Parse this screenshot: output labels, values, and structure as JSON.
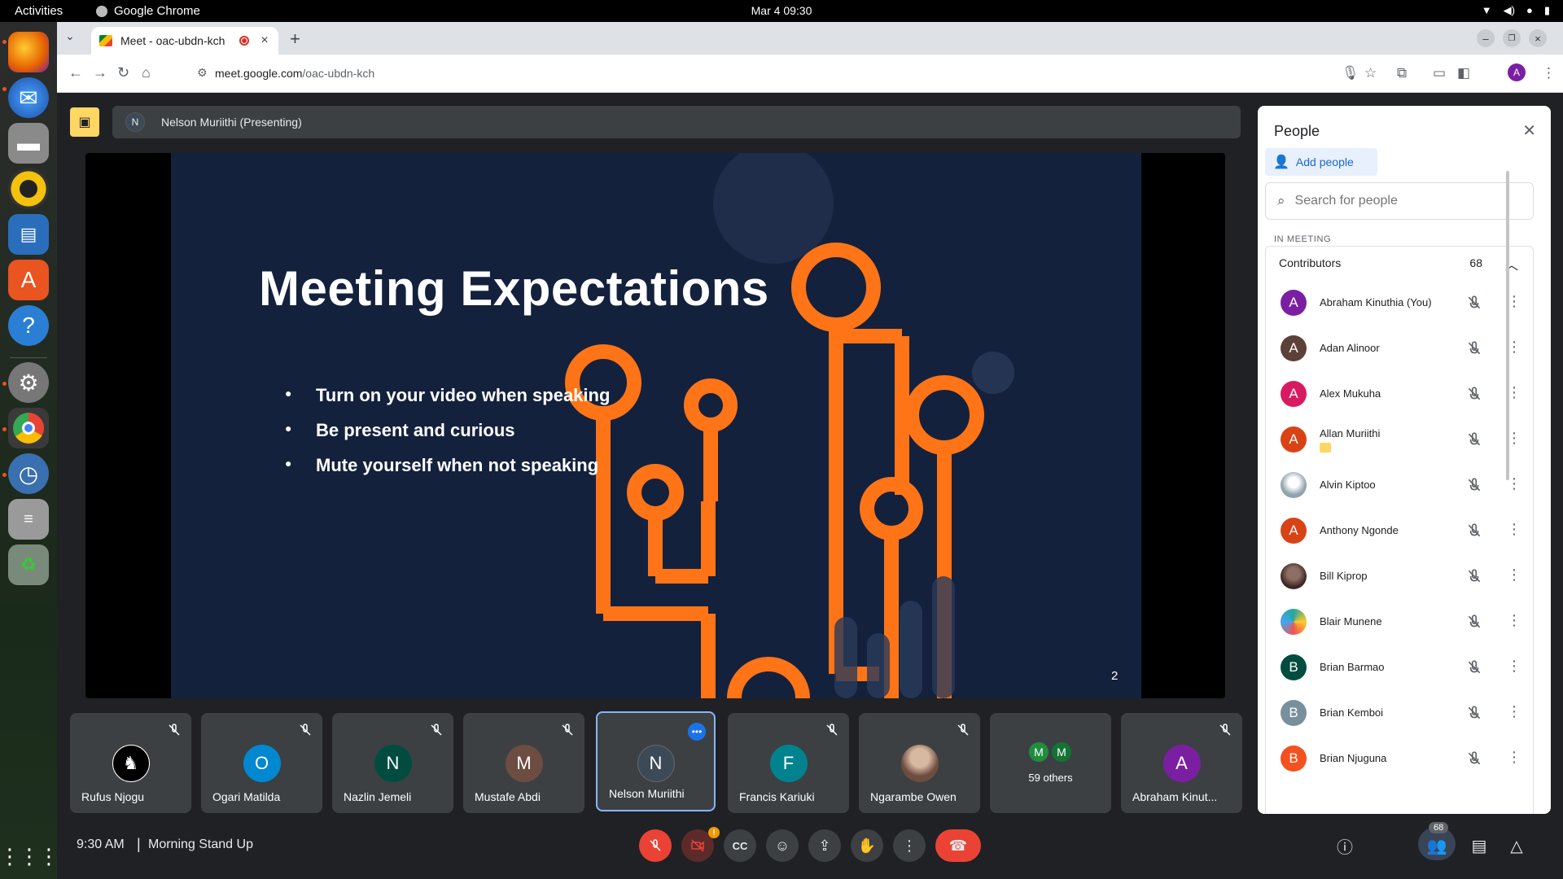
{
  "os": {
    "activities": "Activities",
    "app_name": "Google Chrome",
    "clock": "Mar 4  09:30"
  },
  "dock": {
    "items": [
      {
        "icon": "firefox-icon",
        "color": "#e66000"
      },
      {
        "icon": "thunderbird-icon",
        "color": "#2a6ccc"
      },
      {
        "icon": "files-icon",
        "color": "#8a8a8a"
      },
      {
        "icon": "rhythmbox-icon",
        "color": "#f4c20d"
      },
      {
        "icon": "writer-icon",
        "color": "#2a6ebb"
      },
      {
        "icon": "app-center-icon",
        "color": "#e95420"
      },
      {
        "icon": "help-icon",
        "color": "#2a7fd4"
      },
      {
        "icon": "settings-icon",
        "color": "#777777"
      },
      {
        "icon": "chrome-icon",
        "color": "#4285f4"
      },
      {
        "icon": "timer-icon",
        "color": "#3a6fb0"
      },
      {
        "icon": "storage-icon",
        "color": "#9a9a9a"
      },
      {
        "icon": "trash-icon",
        "color": "#7a8a7a"
      }
    ]
  },
  "browser": {
    "tab_title": "Meet - oac-ubdn-kch",
    "url_host": "meet.google.com",
    "url_path": "/oac-ubdn-kch",
    "profile_initial": "A"
  },
  "meet": {
    "presenter_initial": "N",
    "presenting_label": "Nelson Muriithi (Presenting)",
    "slide": {
      "title": "Meeting Expectations",
      "bullets": [
        "Turn on your video when speaking",
        "Be present and curious",
        "Mute yourself when not speaking"
      ],
      "page": "2"
    },
    "tiles": [
      {
        "initial": "",
        "name": "Rufus Njogu",
        "color": "#000000",
        "muted": true
      },
      {
        "initial": "O",
        "name": "Ogari Matilda",
        "color": "#0288d1",
        "muted": true
      },
      {
        "initial": "N",
        "name": "Nazlin Jemeli",
        "color": "#004d40",
        "muted": true
      },
      {
        "initial": "M",
        "name": "Mustafe Abdi",
        "color": "#6d4c41",
        "muted": true
      },
      {
        "initial": "N",
        "name": "Nelson Muriithi",
        "color": "#3c4a57",
        "muted": false
      },
      {
        "initial": "F",
        "name": "Francis Kariuki",
        "color": "#00838f",
        "muted": true
      },
      {
        "initial": "",
        "name": "Ngarambe Owen",
        "color": "#a1887f",
        "muted": true
      },
      {
        "initial": "M",
        "name": "59 others",
        "color": "#1e8e3e",
        "muted": false
      },
      {
        "initial": "A",
        "name": "Abraham Kinut...",
        "color": "#7b1fa2",
        "muted": true
      }
    ],
    "others_initials": [
      "M",
      "M"
    ],
    "time": "9:30 AM",
    "separator": "|",
    "meeting_title": "Morning Stand Up",
    "participant_count": "68",
    "camera_alert": "!"
  },
  "people_panel": {
    "title": "People",
    "add_people": "Add people",
    "search_placeholder": "Search for people",
    "section_label": "IN MEETING",
    "group_label": "Contributors",
    "group_count": "68",
    "people": [
      {
        "name": "Abraham Kinuthia (You)",
        "initial": "A",
        "color": "#7b1fa2"
      },
      {
        "name": "Adan Alinoor",
        "initial": "A",
        "color": "#5d4037"
      },
      {
        "name": "Alex Mukuha",
        "initial": "A",
        "color": "#d81b60"
      },
      {
        "name": "Allan Muriithi",
        "initial": "A",
        "color": "#d84315"
      },
      {
        "name": "Alvin Kiptoo",
        "initial": "",
        "color": "#90a4ae"
      },
      {
        "name": "Anthony Ngonde",
        "initial": "A",
        "color": "#d84315"
      },
      {
        "name": "Bill Kiprop",
        "initial": "",
        "color": "#4e342e"
      },
      {
        "name": "Blair Munene",
        "initial": "",
        "color": "#26a69a"
      },
      {
        "name": "Brian Barmao",
        "initial": "B",
        "color": "#004d40"
      },
      {
        "name": "Brian Kemboi",
        "initial": "B",
        "color": "#78909c"
      },
      {
        "name": "Brian Njuguna",
        "initial": "B",
        "color": "#f4511e"
      }
    ]
  },
  "colors": {
    "meet_bg": "#202124",
    "slide_bg": "#14213d",
    "accent_orange": "#ff7417",
    "hangup_red": "#ea4335"
  }
}
